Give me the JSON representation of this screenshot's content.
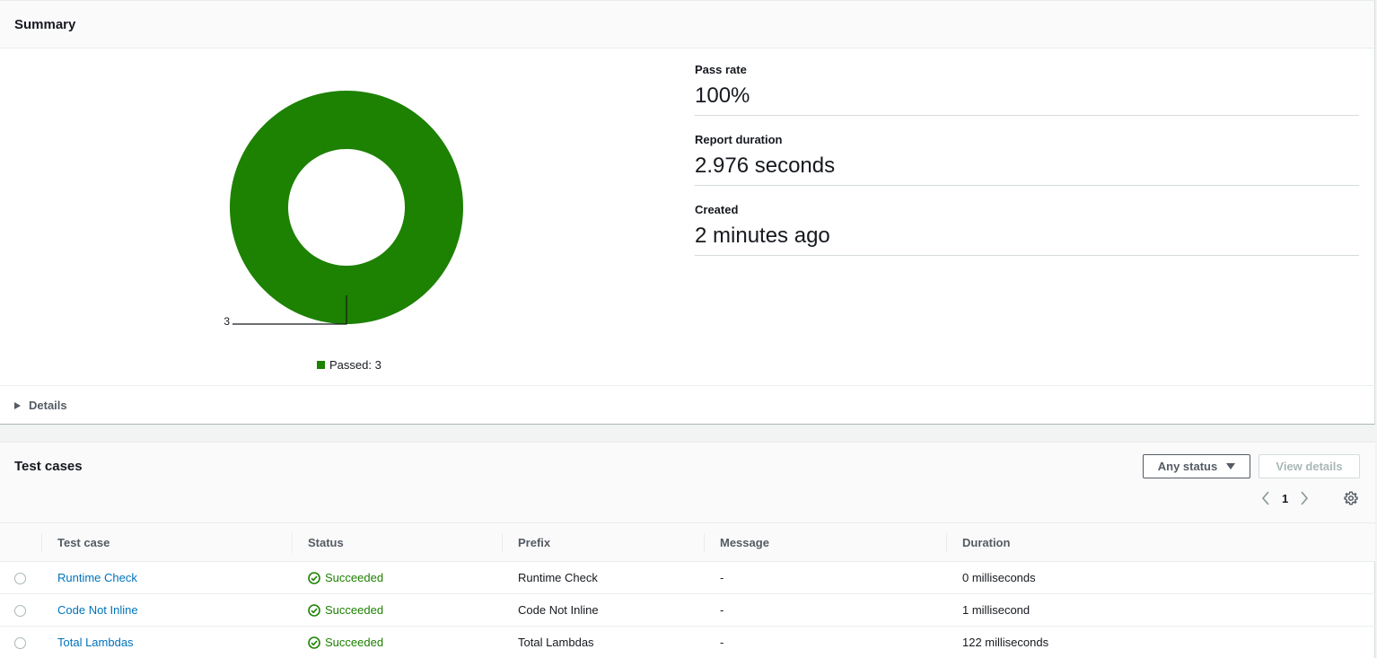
{
  "summary": {
    "title": "Summary",
    "metrics": [
      {
        "label": "Pass rate",
        "value": "100%"
      },
      {
        "label": "Report duration",
        "value": "2.976 seconds"
      },
      {
        "label": "Created",
        "value": "2 minutes ago"
      }
    ],
    "details_label": "Details"
  },
  "chart_data": {
    "type": "pie",
    "slices": [
      {
        "label": "Passed",
        "value": 3,
        "color": "#1d8102"
      }
    ],
    "data_labels": [
      "3"
    ],
    "legend": [
      "Passed: 3"
    ],
    "legend_position": "bottom"
  },
  "test_cases": {
    "title": "Test cases",
    "filter_label": "Any status",
    "view_details_label": "View details",
    "page": "1",
    "columns": [
      "Test case",
      "Status",
      "Prefix",
      "Message",
      "Duration"
    ],
    "rows": [
      {
        "name": "Runtime Check",
        "status": "Succeeded",
        "prefix": "Runtime Check",
        "message": "-",
        "duration": "0 milliseconds"
      },
      {
        "name": "Code Not Inline",
        "status": "Succeeded",
        "prefix": "Code Not Inline",
        "message": "-",
        "duration": "1 millisecond"
      },
      {
        "name": "Total Lambdas",
        "status": "Succeeded",
        "prefix": "Total Lambdas",
        "message": "-",
        "duration": "122 milliseconds"
      }
    ]
  },
  "colors": {
    "success": "#1d8102",
    "link": "#0073bb"
  }
}
